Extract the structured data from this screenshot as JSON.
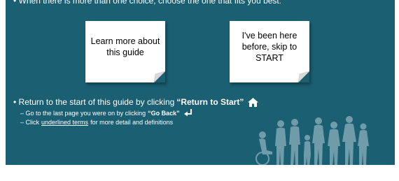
{
  "slide": {
    "top_instruction": "• When there is more than one choice, choose the one that fits you best:",
    "notes": [
      {
        "text": "Learn more about this guide"
      },
      {
        "text": "I've been here before, skip to START"
      }
    ],
    "bullet_main": {
      "prefix": "• Return to the start of this guide by clicking",
      "bold": "“Return to Start”",
      "icon": "home-icon"
    },
    "sub_go_back": {
      "prefix": "– Go to the last page you were on by clicking",
      "bold": "“Go Back”",
      "icon": "return-arrow-icon"
    },
    "sub_terms": {
      "prefix": "– Click",
      "link": "underlined terms",
      "suffix": "for more detail and definitions"
    },
    "colors": {
      "background": "#1b5f73",
      "note": "#ffffff",
      "silhouette": "#7fa7b3"
    }
  }
}
